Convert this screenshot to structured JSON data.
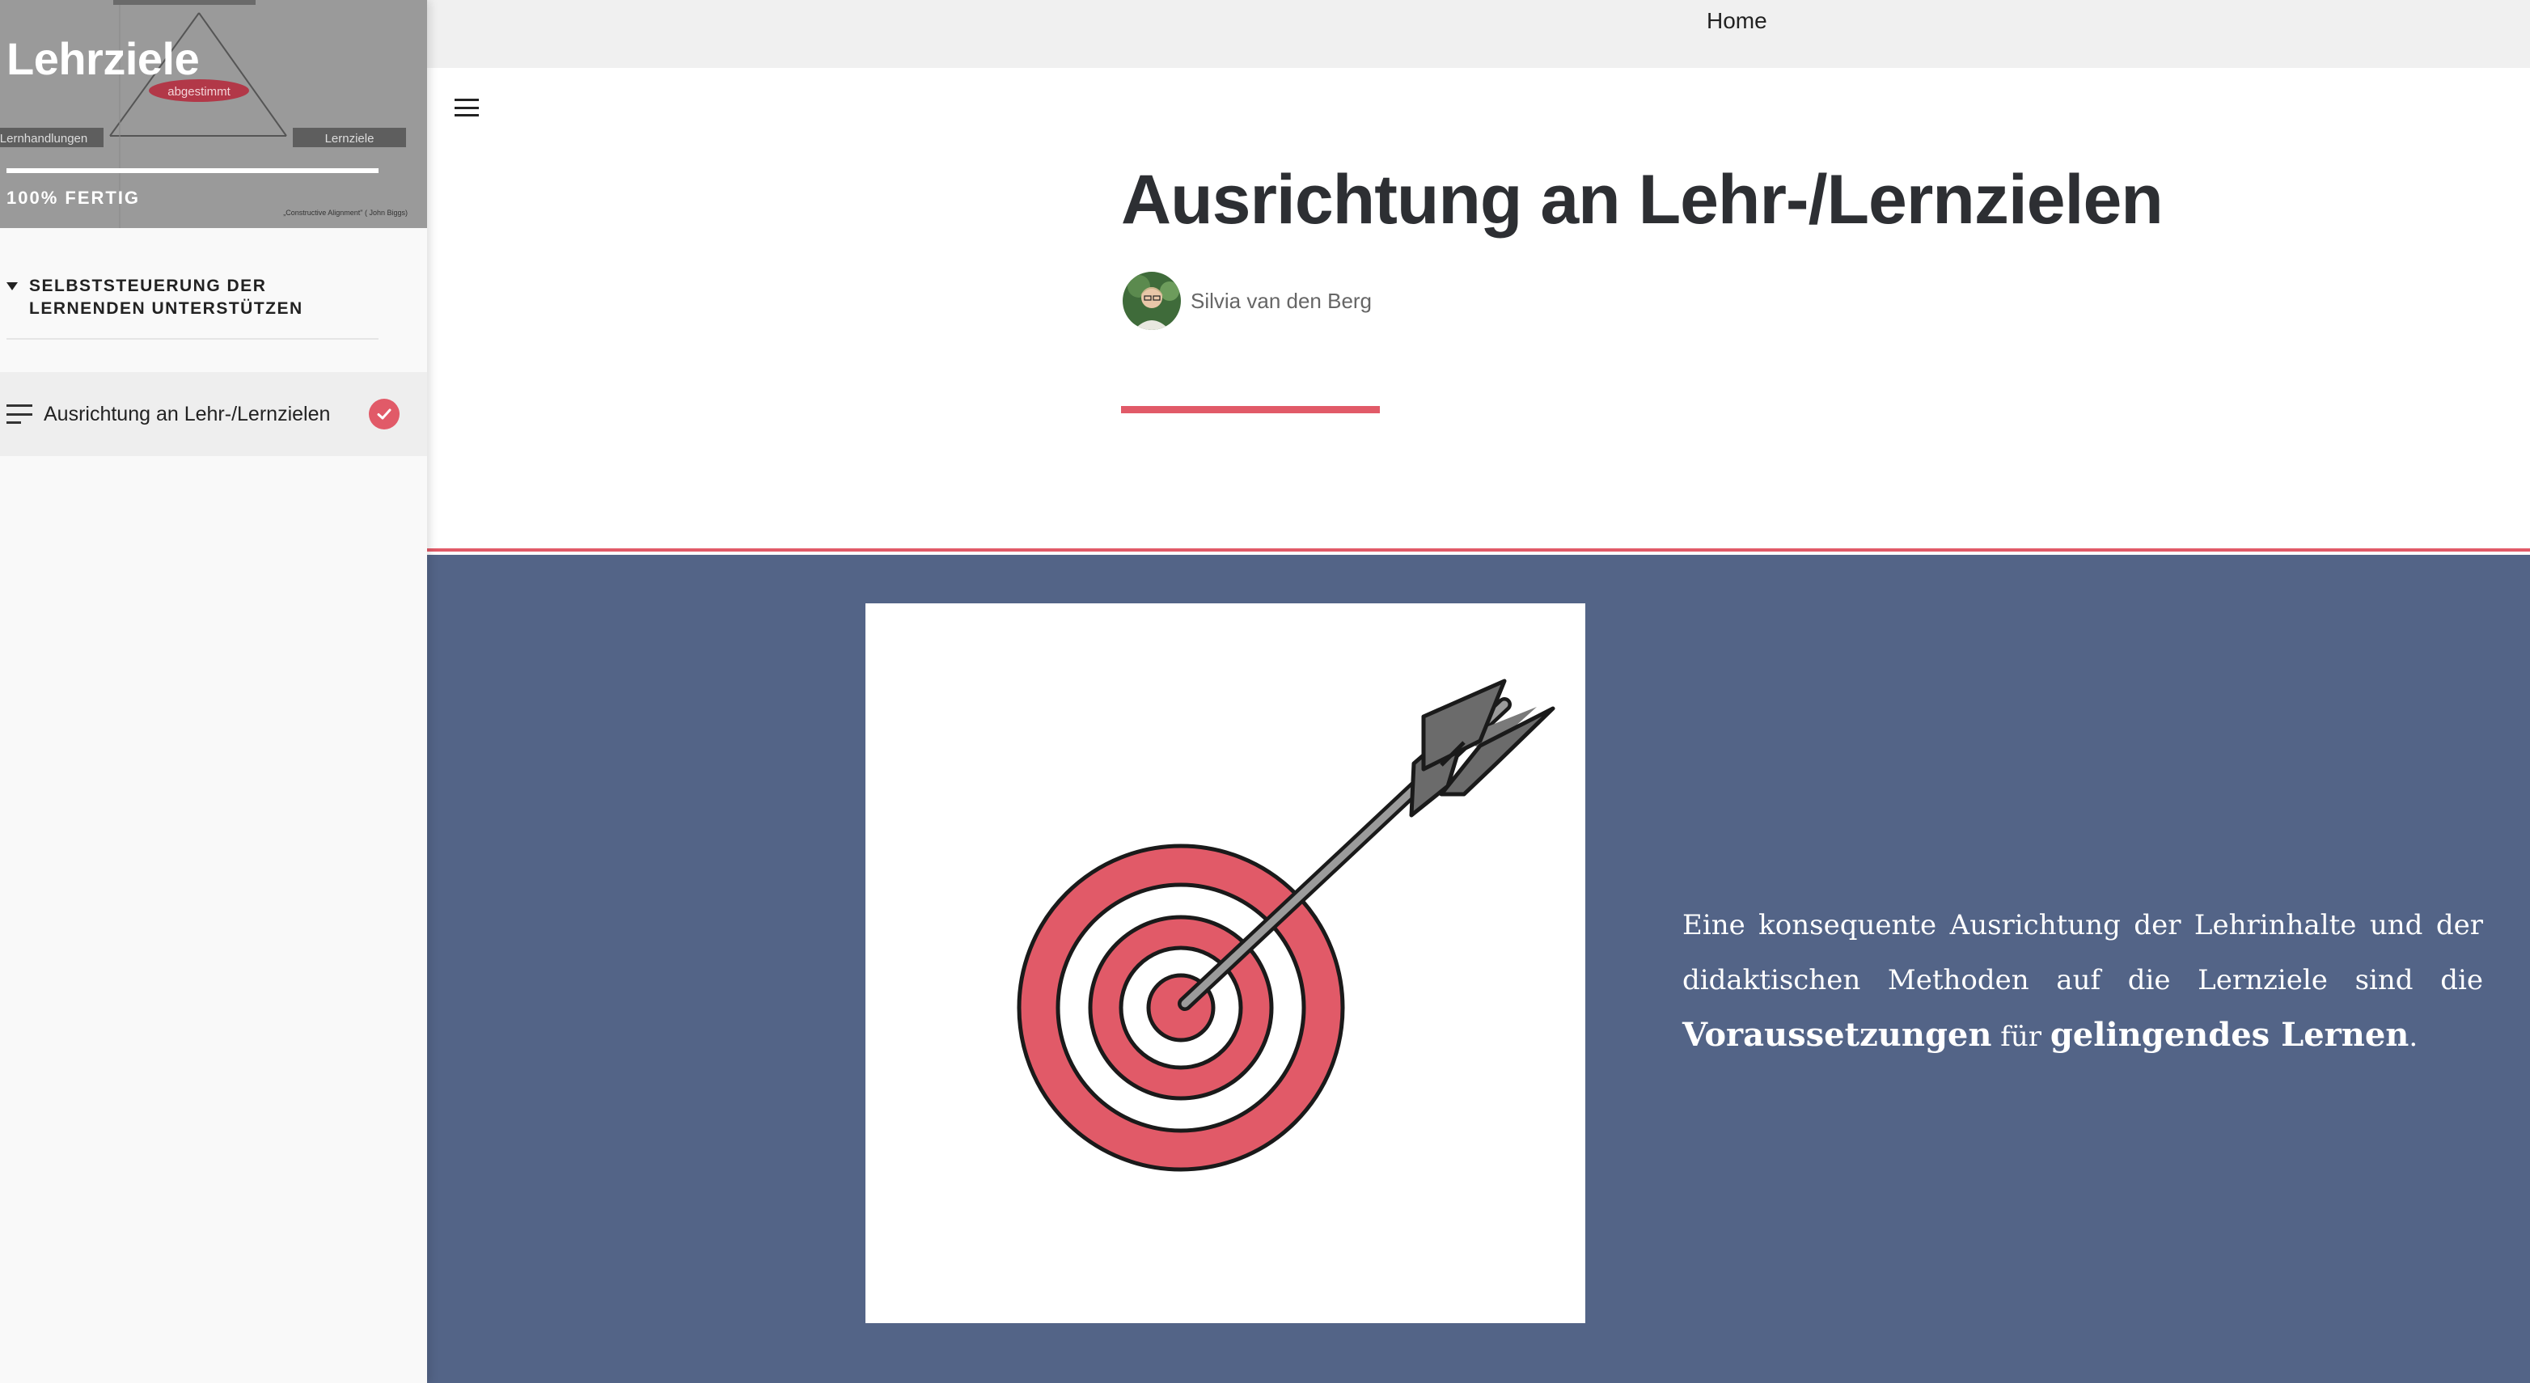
{
  "sidebar": {
    "course_title": "Lehrziele",
    "progress_value": 100,
    "progress_label": "100% FERTIG",
    "header_diagram": {
      "node_top": "",
      "node_left": "Lernhandlungen",
      "node_right": "Lernziele",
      "center_label": "abgestimmt",
      "caption": "„Constructive Alignment\" ( John Biggs)"
    },
    "section_label": "SELBSTSTEUERUNG DER LERNENDEN UNTERSTÜTZEN",
    "lessons": [
      {
        "label": "Ausrichtung an Lehr-/Lernzielen",
        "completed": true
      }
    ]
  },
  "topbar": {
    "home_label": "Home"
  },
  "lesson": {
    "title": "Ausrichtung an Lehr-/Lernzielen",
    "author_name": "Silvia van den Berg",
    "body": {
      "part1": "Eine konsequente Ausrichtung der Lehrinhalte und der didaktischen Methoden auf die Lernziele sind die ",
      "bold1": "Voraussetzungen",
      "part2": " für ",
      "bold2": "gelingendes Lernen",
      "part3": "."
    },
    "image_icon": "target-with-arrow"
  },
  "colors": {
    "accent": "#e15a68",
    "band": "#536487",
    "topbar": "#f0f0f0",
    "sidebar": "#f9f9f9"
  }
}
